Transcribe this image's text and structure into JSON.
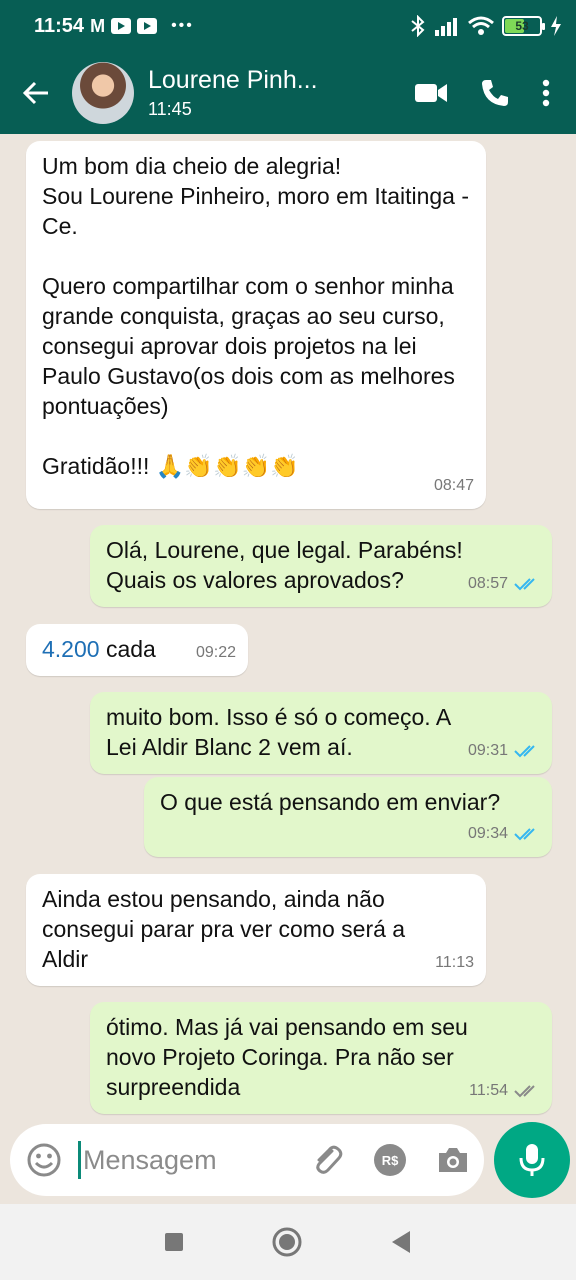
{
  "status_bar": {
    "time": "11:54",
    "battery": "53"
  },
  "header": {
    "contact_name": "Lourene Pinh...",
    "last_seen": "11:45"
  },
  "messages": [
    {
      "direction": "in",
      "text": "Um bom dia cheio de alegria!\nSou Lourene Pinheiro, moro em Itaitinga -Ce.\n\nQuero compartilhar com o senhor minha grande conquista, graças ao seu curso, consegui aprovar dois projetos na lei Paulo Gustavo(os dois com as melhores pontuações)\n\nGratidão!!! 🙏👏👏👏👏",
      "time": "08:47"
    },
    {
      "direction": "out",
      "text": "Olá, Lourene, que legal. Parabéns!\nQuais os valores aprovados?",
      "time": "08:57",
      "status": "read"
    },
    {
      "direction": "in",
      "text_link": "4.200",
      "text_rest": " cada",
      "time": "09:22"
    },
    {
      "direction": "out",
      "text": "muito bom. Isso é só o começo. A\nLei Aldir Blanc 2 vem aí.",
      "time": "09:31",
      "status": "read"
    },
    {
      "direction": "out",
      "text": "O que está pensando em enviar?",
      "time": "09:34",
      "status": "read"
    },
    {
      "direction": "in",
      "text": "Ainda estou pensando, ainda não\nconsegui parar pra ver como será a\nAldir",
      "time": "11:13"
    },
    {
      "direction": "out",
      "text": "ótimo. Mas já vai pensando em seu\nnovo Projeto Coringa. Pra não ser\nsurpreendida",
      "time": "11:54",
      "status": "delivered"
    }
  ],
  "composer": {
    "placeholder": "Mensagem",
    "currency_label": "R$"
  },
  "colors": {
    "header": "#075e54",
    "outgoing_bubble": "#e2f7cb",
    "incoming_bubble": "#ffffff",
    "read_ticks": "#34b7f1",
    "mic_button": "#00a884"
  }
}
